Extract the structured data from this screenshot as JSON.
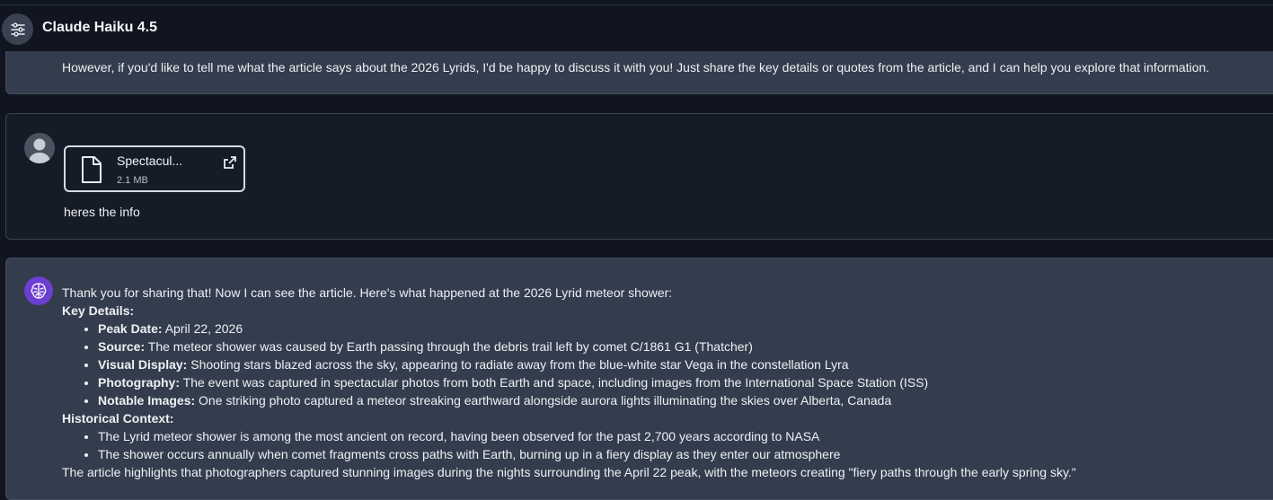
{
  "header": {
    "model_name": "Claude Haiku 4.5",
    "settings_icon": "sliders-icon"
  },
  "previous_message": {
    "text": "However, if you'd like to tell me what the article says about the 2026 Lyrids, I'd be happy to discuss it with you! Just share the key details or quotes from the article, and I can help you explore that information."
  },
  "user_message": {
    "avatar_icon": "user-avatar-icon",
    "attachment": {
      "name": "Spectacul...",
      "size": "2.1 MB",
      "icon": "document-icon",
      "open_icon": "external-link-icon"
    },
    "text": "heres the info"
  },
  "assistant_message": {
    "avatar_icon": "ai-brain-icon",
    "intro": "Thank you for sharing that! Now I can see the article. Here's what happened at the 2026 Lyrid meteor shower:",
    "key_details_heading": "Key Details:",
    "key_details": [
      {
        "label": "Peak Date:",
        "text": " April 22, 2026"
      },
      {
        "label": "Source:",
        "text": " The meteor shower was caused by Earth passing through the debris trail left by comet C/1861 G1 (Thatcher)"
      },
      {
        "label": "Visual Display:",
        "text": " Shooting stars blazed across the sky, appearing to radiate away from the blue-white star Vega in the constellation Lyra"
      },
      {
        "label": "Photography:",
        "text": " The event was captured in spectacular photos from both Earth and space, including images from the International Space Station (ISS)"
      },
      {
        "label": "Notable Images:",
        "text": " One striking photo captured a meteor streaking earthward alongside aurora lights illuminating the skies over Alberta, Canada"
      }
    ],
    "historical_heading": "Historical Context:",
    "historical": [
      "The Lyrid meteor shower is among the most ancient on record, having been observed for the past 2,700 years according to NASA",
      "The shower occurs annually when comet fragments cross paths with Earth, burning up in a fiery display as they enter our atmosphere"
    ],
    "conclusion": "The article highlights that photographers captured stunning images during the nights surrounding the April 22 peak, with the meteors creating \"fiery paths through the early spring sky.\""
  }
}
